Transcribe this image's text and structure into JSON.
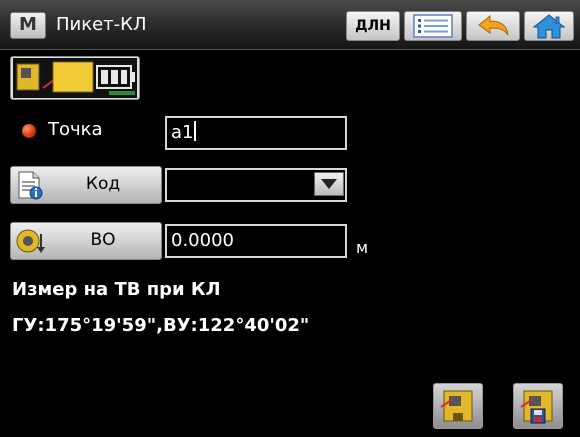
{
  "titlebar": {
    "menu_label": "M",
    "title": "Пикет-КЛ",
    "dln_label": "ДЛН",
    "icons": [
      "list-icon",
      "undo-arrow-icon",
      "home-icon"
    ]
  },
  "mode_icon": "total-station-prism-battery-icon",
  "point": {
    "label": "Точка",
    "value": "a1"
  },
  "code": {
    "button_label": "Код",
    "value": ""
  },
  "backsight": {
    "button_label": "ВО",
    "value": "0.0000",
    "unit": "м"
  },
  "status": {
    "line1": "Измер на ТВ при КЛ",
    "line2": "ГУ:175°19'59\",ВУ:122°40'02\""
  },
  "bottom_buttons": [
    "measure-icon",
    "measure-save-icon"
  ],
  "colors": {
    "background": "#000000",
    "dot": "#d8380e",
    "home": "#2f8fd8",
    "undo": "#f2a21c"
  }
}
